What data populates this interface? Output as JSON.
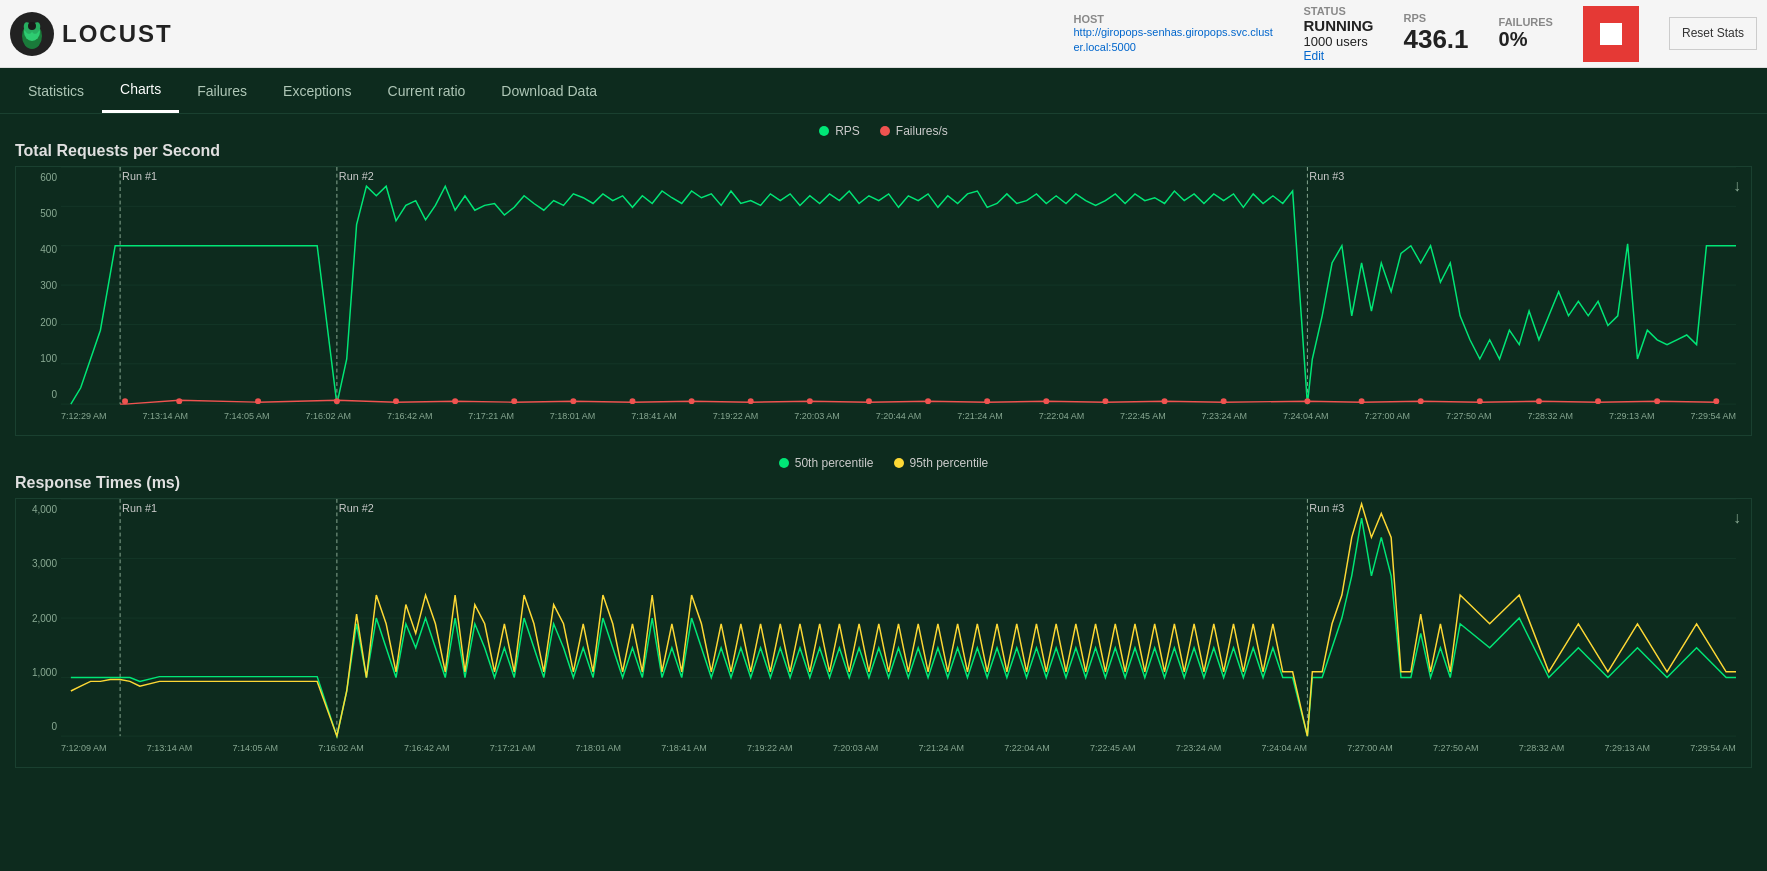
{
  "header": {
    "logo_text": "LOCUST",
    "host_label": "HOST",
    "host_value": "http://giropops-senhas.giropops.svc.cluster.local:5000",
    "status_label": "STATUS",
    "status_value": "RUNNING",
    "users_value": "1000 users",
    "edit_label": "Edit",
    "rps_label": "RPS",
    "rps_value": "436.1",
    "failures_label": "FAILURES",
    "failures_value": "0%",
    "stop_label": "STOP",
    "reset_label": "Reset Stats"
  },
  "nav": {
    "items": [
      {
        "id": "statistics",
        "label": "Statistics",
        "active": false
      },
      {
        "id": "charts",
        "label": "Charts",
        "active": true
      },
      {
        "id": "failures",
        "label": "Failures",
        "active": false
      },
      {
        "id": "exceptions",
        "label": "Exceptions",
        "active": false
      },
      {
        "id": "current-ratio",
        "label": "Current ratio",
        "active": false
      },
      {
        "id": "download-data",
        "label": "Download Data",
        "active": false
      }
    ]
  },
  "charts": {
    "rps_chart": {
      "title": "Total Requests per Second",
      "legend": [
        {
          "id": "rps",
          "label": "RPS",
          "color": "#00e676"
        },
        {
          "id": "failures",
          "label": "Failures/s",
          "color": "#ef5350"
        }
      ],
      "y_labels": [
        "600",
        "500",
        "400",
        "300",
        "200",
        "100",
        "0"
      ],
      "x_labels": [
        "7:12:29 AM",
        "7:13:14 AM",
        "7:14:05 AM",
        "7:16:02 AM",
        "7:16:42 AM",
        "7:17:21 AM",
        "7:18:01 AM",
        "7:18:41 AM",
        "7:19:22 AM",
        "7:20:03 AM",
        "7:20:44 AM",
        "7:21:24 AM",
        "7:22:04 AM",
        "7:22:45 AM",
        "7:23:24 AM",
        "7:24:04 AM",
        "7:27:00 AM",
        "7:27:50 AM",
        "7:28:32 AM",
        "7:29:13 AM",
        "7:29:54 AM"
      ],
      "run_markers": [
        {
          "label": "Run #1",
          "x_pct": 3.5
        },
        {
          "label": "Run #2",
          "x_pct": 16.5
        },
        {
          "label": "Run #3",
          "x_pct": 74.5
        }
      ]
    },
    "response_chart": {
      "title": "Response Times (ms)",
      "legend": [
        {
          "id": "p50",
          "label": "50th percentile",
          "color": "#00e676"
        },
        {
          "id": "p95",
          "label": "95th percentile",
          "color": "#fdd835"
        }
      ],
      "y_labels": [
        "4,000",
        "3,000",
        "2,000",
        "1,000",
        "0"
      ],
      "x_labels": [
        "7:12:09 AM",
        "7:13:14 AM",
        "7:14:05 AM",
        "7:16:02 AM",
        "7:16:42 AM",
        "7:17:21 AM",
        "7:18:01 AM",
        "7:18:41 AM",
        "7:19:22 AM",
        "7:20:03 AM",
        "7:21:24 AM",
        "7:22:04 AM",
        "7:22:45 AM",
        "7:23:24 AM",
        "7:24:04 AM",
        "7:27:00 AM",
        "7:27:50 AM",
        "7:28:32 AM",
        "7:29:13 AM",
        "7:29:54 AM"
      ],
      "run_markers": [
        {
          "label": "Run #1",
          "x_pct": 3.5
        },
        {
          "label": "Run #2",
          "x_pct": 16.5
        },
        {
          "label": "Run #3",
          "x_pct": 74.5
        }
      ]
    }
  }
}
